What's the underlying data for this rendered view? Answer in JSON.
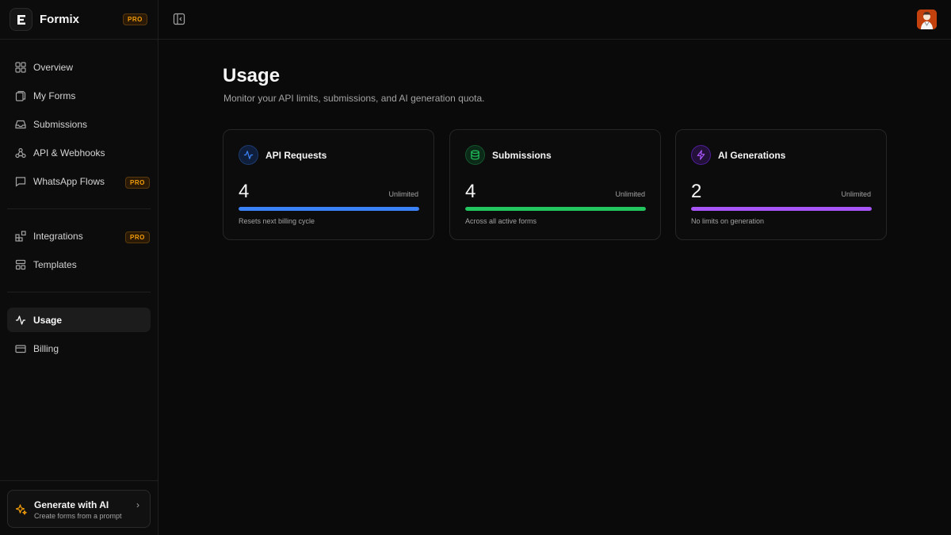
{
  "brand": {
    "name": "Formix",
    "badge": "PRO"
  },
  "nav": {
    "main": [
      {
        "label": "Overview",
        "icon": "grid-icon"
      },
      {
        "label": "My Forms",
        "icon": "files-icon"
      },
      {
        "label": "Submissions",
        "icon": "inbox-icon"
      },
      {
        "label": "API & Webhooks",
        "icon": "webhook-icon"
      },
      {
        "label": "WhatsApp Flows",
        "icon": "message-icon",
        "badge": "PRO"
      }
    ],
    "secondary": [
      {
        "label": "Integrations",
        "icon": "blocks-icon",
        "badge": "PRO"
      },
      {
        "label": "Templates",
        "icon": "layout-icon"
      }
    ],
    "account": [
      {
        "label": "Usage",
        "icon": "activity-icon",
        "active": true
      },
      {
        "label": "Billing",
        "icon": "credit-card-icon"
      }
    ]
  },
  "ai_card": {
    "title": "Generate with AI",
    "subtitle": "Create forms from a prompt",
    "chevron": "›"
  },
  "page": {
    "title": "Usage",
    "subtitle": "Monitor your API limits, submissions, and AI generation quota."
  },
  "cards": [
    {
      "title": "API Requests",
      "icon": "activity-icon",
      "value": "4",
      "limit": "Unlimited",
      "note": "Resets next billing cycle",
      "color": "#3b82f6",
      "icon_bg": "#0f1e3a",
      "icon_border": "#1e3a6e",
      "progress_percent": 100
    },
    {
      "title": "Submissions",
      "icon": "database-icon",
      "value": "4",
      "limit": "Unlimited",
      "note": "Across all active forms",
      "color": "#22c55e",
      "icon_bg": "#0b2a17",
      "icon_border": "#14532d",
      "progress_percent": 100
    },
    {
      "title": "AI Generations",
      "icon": "zap-icon",
      "value": "2",
      "limit": "Unlimited",
      "note": "No limits on generation",
      "color": "#a855f7",
      "icon_bg": "#23113a",
      "icon_border": "#4c1d95",
      "progress_percent": 100
    }
  ]
}
